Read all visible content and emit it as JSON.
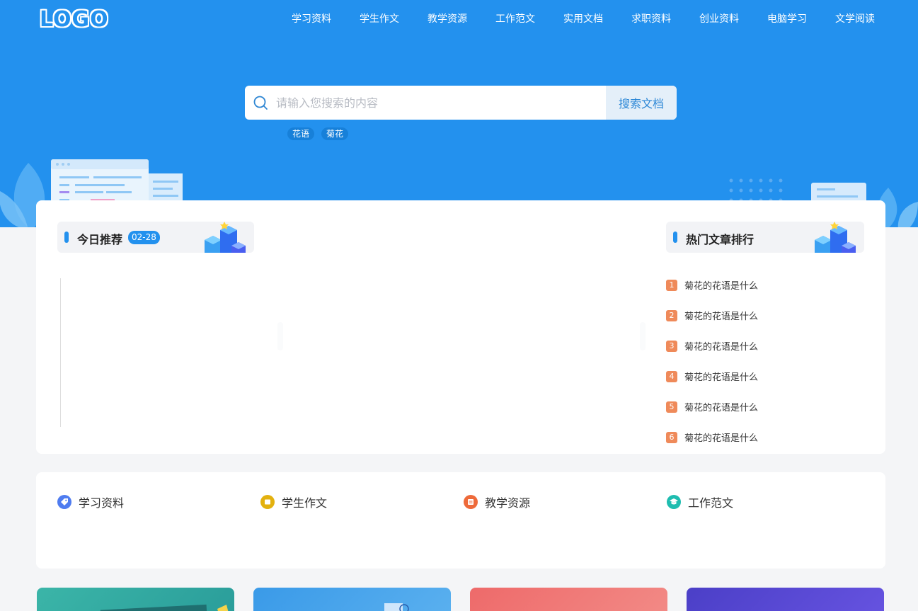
{
  "header": {
    "logo": "LOGO",
    "nav": [
      "学习资料",
      "学生作文",
      "教学资源",
      "工作范文",
      "实用文档",
      "求职资料",
      "创业资料",
      "电脑学习",
      "文学阅读"
    ]
  },
  "search": {
    "placeholder": "请输入您搜索的内容",
    "button": "搜索文档",
    "tags": [
      "花语",
      "菊花"
    ]
  },
  "today": {
    "title": "今日推荐",
    "date": "02-28"
  },
  "hot": {
    "title": "热门文章排行",
    "items": [
      {
        "rank": "1",
        "title": "菊花的花语是什么"
      },
      {
        "rank": "2",
        "title": "菊花的花语是什么"
      },
      {
        "rank": "3",
        "title": "菊花的花语是什么"
      },
      {
        "rank": "4",
        "title": "菊花的花语是什么"
      },
      {
        "rank": "5",
        "title": "菊花的花语是什么"
      },
      {
        "rank": "6",
        "title": "菊花的花语是什么"
      }
    ]
  },
  "categories": [
    {
      "label": "学习资料",
      "icon": "tag-icon",
      "color": "#4f7cf0"
    },
    {
      "label": "学生作文",
      "icon": "note-icon",
      "color": "#e3b10f"
    },
    {
      "label": "教学资源",
      "icon": "book-icon",
      "color": "#ee6a3a"
    },
    {
      "label": "工作范文",
      "icon": "graduation-cap-icon",
      "color": "#1fbdb0"
    }
  ],
  "colors": {
    "brand": "#2391ee",
    "rank_badge": "#ef8a5a",
    "page_bg": "#f4f5f7"
  }
}
